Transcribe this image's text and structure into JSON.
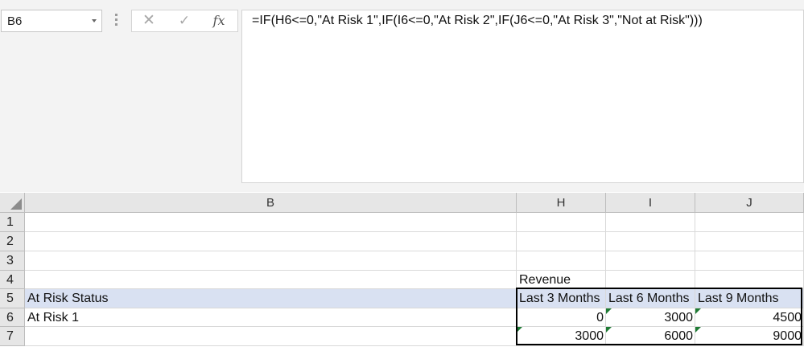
{
  "name_box": {
    "value": "B6"
  },
  "formula_bar": {
    "cancel_glyph": "✕",
    "enter_glyph": "✓",
    "fx_label": "fx",
    "formula": "=IF(H6<=0,\"At Risk 1\",IF(I6<=0,\"At Risk 2\",IF(J6<=0,\"At Risk 3\",\"Not at Risk\")))"
  },
  "columns": [
    {
      "label": "B"
    },
    {
      "label": "H"
    },
    {
      "label": "I"
    },
    {
      "label": "J"
    }
  ],
  "rows": [
    {
      "num": "1",
      "cells": [
        "",
        "",
        "",
        ""
      ]
    },
    {
      "num": "2",
      "cells": [
        "",
        "",
        "",
        ""
      ]
    },
    {
      "num": "3",
      "cells": [
        "",
        "",
        "",
        ""
      ]
    },
    {
      "num": "4",
      "cells": [
        "",
        "Revenue",
        "",
        ""
      ]
    },
    {
      "num": "5",
      "cells": [
        "At Risk Status",
        "Last 3 Months",
        "Last 6 Months",
        "Last 9 Months"
      ]
    },
    {
      "num": "6",
      "cells": [
        "At Risk 1",
        "0",
        "3000",
        "4500"
      ]
    },
    {
      "num": "7",
      "cells": [
        "",
        "3000",
        "6000",
        "9000"
      ]
    }
  ],
  "colors": {
    "header_highlight": "#d9e1f2",
    "error_indicator": "#1e7b34"
  }
}
